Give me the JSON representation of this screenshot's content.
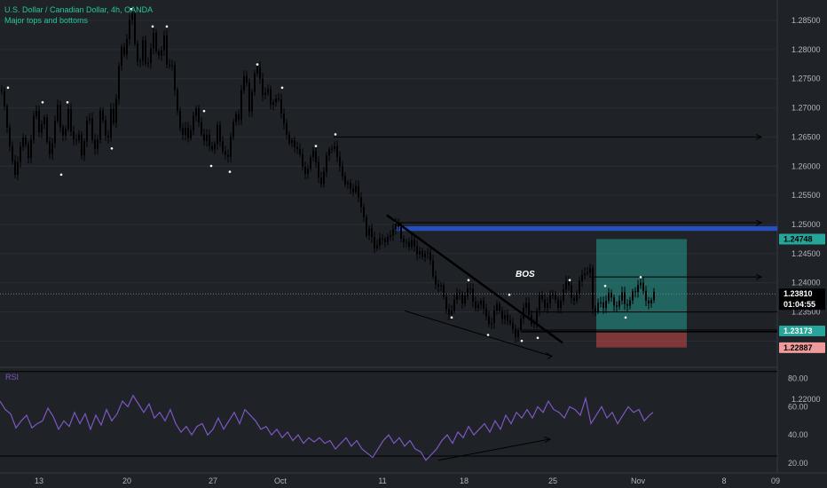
{
  "header": {
    "title": "U.S. Dollar / Canadian Dollar, 4h, OANDA",
    "indicator": "Major tops and bottoms"
  },
  "colors": {
    "background": "#1f2227",
    "candle": "#000000",
    "marker": "#ffffff",
    "rsi_line": "#7e57c2",
    "blue_zone": "#2962ff",
    "target_zone": "#26a69a",
    "stop_zone": "#ef5350",
    "accent_text": "#26c6a0"
  },
  "chart_data": [
    {
      "type": "candlestick",
      "title": "U.S. Dollar / Canadian Dollar, 4h, OANDA",
      "ylim": [
        1.2255,
        1.2885
      ],
      "y_ticks": [
        "1.22000",
        "1.23500",
        "1.24000",
        "1.24500",
        "1.25000",
        "1.25500",
        "1.26000",
        "1.26500",
        "1.27000",
        "1.27500",
        "1.28000",
        "1.28500"
      ],
      "x_ticks": [
        "13",
        "20",
        "27",
        "Oct",
        "11",
        "18",
        "25",
        "Nov",
        "8",
        "09"
      ],
      "close_path": [
        [
          0,
          1.273
        ],
        [
          4,
          1.27
        ],
        [
          8,
          1.266
        ],
        [
          12,
          1.262
        ],
        [
          16,
          1.258
        ],
        [
          20,
          1.261
        ],
        [
          24,
          1.266
        ],
        [
          28,
          1.264
        ],
        [
          32,
          1.26
        ],
        [
          36,
          1.268
        ],
        [
          40,
          1.27
        ],
        [
          44,
          1.265
        ],
        [
          48,
          1.269
        ],
        [
          52,
          1.264
        ],
        [
          56,
          1.262
        ],
        [
          60,
          1.267
        ],
        [
          64,
          1.27
        ],
        [
          68,
          1.265
        ],
        [
          72,
          1.266
        ],
        [
          76,
          1.27
        ],
        [
          80,
          1.264
        ],
        [
          84,
          1.264
        ],
        [
          88,
          1.266
        ],
        [
          92,
          1.261
        ],
        [
          96,
          1.267
        ],
        [
          100,
          1.268
        ],
        [
          104,
          1.264
        ],
        [
          108,
          1.263
        ],
        [
          112,
          1.269
        ],
        [
          116,
          1.267
        ],
        [
          120,
          1.264
        ],
        [
          124,
          1.27
        ],
        [
          128,
          1.266
        ],
        [
          132,
          1.276
        ],
        [
          136,
          1.281
        ],
        [
          140,
          1.279
        ],
        [
          144,
          1.284
        ],
        [
          148,
          1.286
        ],
        [
          152,
          1.28
        ],
        [
          156,
          1.277
        ],
        [
          160,
          1.281
        ],
        [
          164,
          1.276
        ],
        [
          168,
          1.28
        ],
        [
          172,
          1.283
        ],
        [
          176,
          1.278
        ],
        [
          180,
          1.279
        ],
        [
          184,
          1.283
        ],
        [
          188,
          1.276
        ],
        [
          192,
          1.278
        ],
        [
          196,
          1.273
        ],
        [
          200,
          1.269
        ],
        [
          204,
          1.265
        ],
        [
          208,
          1.266
        ],
        [
          212,
          1.264
        ],
        [
          216,
          1.269
        ],
        [
          220,
          1.27
        ],
        [
          224,
          1.266
        ],
        [
          228,
          1.264
        ],
        [
          232,
          1.266
        ],
        [
          236,
          1.263
        ],
        [
          240,
          1.262
        ],
        [
          244,
          1.267
        ],
        [
          248,
          1.264
        ],
        [
          252,
          1.262
        ],
        [
          256,
          1.261
        ],
        [
          260,
          1.266
        ],
        [
          264,
          1.27
        ],
        [
          268,
          1.268
        ],
        [
          272,
          1.274
        ],
        [
          276,
          1.276
        ],
        [
          280,
          1.27
        ],
        [
          284,
          1.274
        ],
        [
          288,
          1.277
        ],
        [
          292,
          1.275
        ],
        [
          296,
          1.272
        ],
        [
          300,
          1.274
        ],
        [
          304,
          1.27
        ],
        [
          308,
          1.271
        ],
        [
          312,
          1.273
        ],
        [
          316,
          1.269
        ],
        [
          320,
          1.266
        ],
        [
          324,
          1.264
        ],
        [
          328,
          1.265
        ],
        [
          332,
          1.263
        ],
        [
          336,
          1.262
        ],
        [
          340,
          1.26
        ],
        [
          344,
          1.259
        ],
        [
          348,
          1.261
        ],
        [
          352,
          1.262
        ],
        [
          356,
          1.26
        ],
        [
          360,
          1.257
        ],
        [
          364,
          1.259
        ],
        [
          368,
          1.262
        ],
        [
          372,
          1.263
        ],
        [
          376,
          1.264
        ],
        [
          380,
          1.261
        ],
        [
          384,
          1.258
        ],
        [
          388,
          1.257
        ],
        [
          392,
          1.258
        ],
        [
          396,
          1.255
        ],
        [
          400,
          1.256
        ],
        [
          404,
          1.254
        ],
        [
          408,
          1.253
        ],
        [
          412,
          1.248
        ],
        [
          416,
          1.249
        ],
        [
          420,
          1.246
        ],
        [
          424,
          1.247
        ],
        [
          428,
          1.248
        ],
        [
          432,
          1.246
        ],
        [
          436,
          1.248
        ],
        [
          440,
          1.249
        ],
        [
          444,
          1.25
        ],
        [
          448,
          1.249
        ],
        [
          452,
          1.247
        ],
        [
          456,
          1.248
        ],
        [
          460,
          1.246
        ],
        [
          464,
          1.247
        ],
        [
          468,
          1.245
        ],
        [
          472,
          1.246
        ],
        [
          476,
          1.244
        ],
        [
          480,
          1.245
        ],
        [
          484,
          1.244
        ],
        [
          488,
          1.241
        ],
        [
          492,
          1.239
        ],
        [
          496,
          1.239
        ],
        [
          500,
          1.237
        ],
        [
          504,
          1.235
        ],
        [
          508,
          1.235
        ],
        [
          512,
          1.237
        ],
        [
          516,
          1.239
        ],
        [
          520,
          1.237
        ],
        [
          524,
          1.238
        ],
        [
          528,
          1.239
        ],
        [
          532,
          1.237
        ],
        [
          536,
          1.236
        ],
        [
          540,
          1.237
        ],
        [
          544,
          1.235
        ],
        [
          548,
          1.234
        ],
        [
          552,
          1.233
        ],
        [
          556,
          1.235
        ],
        [
          560,
          1.236
        ],
        [
          564,
          1.234
        ],
        [
          568,
          1.235
        ],
        [
          572,
          1.233
        ],
        [
          576,
          1.232
        ],
        [
          580,
          1.231
        ],
        [
          584,
          1.233
        ],
        [
          588,
          1.235
        ],
        [
          592,
          1.236
        ],
        [
          596,
          1.234
        ],
        [
          600,
          1.233
        ],
        [
          604,
          1.235
        ],
        [
          608,
          1.238
        ],
        [
          612,
          1.236
        ],
        [
          616,
          1.237
        ],
        [
          620,
          1.238
        ],
        [
          624,
          1.237
        ],
        [
          628,
          1.236
        ],
        [
          632,
          1.238
        ],
        [
          636,
          1.24
        ],
        [
          640,
          1.239
        ],
        [
          644,
          1.237
        ],
        [
          648,
          1.238
        ],
        [
          652,
          1.24
        ],
        [
          656,
          1.241
        ],
        [
          660,
          1.242
        ],
        [
          664,
          1.243
        ],
        [
          668,
          1.233
        ],
        [
          672,
          1.236
        ],
        [
          676,
          1.237
        ],
        [
          680,
          1.236
        ],
        [
          684,
          1.238
        ],
        [
          688,
          1.237
        ],
        [
          692,
          1.236
        ],
        [
          696,
          1.237
        ],
        [
          700,
          1.238
        ],
        [
          704,
          1.235
        ],
        [
          708,
          1.237
        ],
        [
          712,
          1.239
        ],
        [
          716,
          1.238
        ],
        [
          720,
          1.24
        ],
        [
          724,
          1.239
        ],
        [
          728,
          1.237
        ],
        [
          732,
          1.236
        ],
        [
          736,
          1.238
        ]
      ],
      "top_markers": [
        [
          9,
          1.273
        ],
        [
          48,
          1.2705
        ],
        [
          76,
          1.2705
        ],
        [
          148,
          1.2865
        ],
        [
          172,
          1.2835
        ],
        [
          188,
          1.2835
        ],
        [
          230,
          1.269
        ],
        [
          290,
          1.277
        ],
        [
          318,
          1.273
        ],
        [
          356,
          1.263
        ],
        [
          378,
          1.265
        ],
        [
          446,
          1.25
        ],
        [
          528,
          1.24
        ],
        [
          574,
          1.2375
        ],
        [
          642,
          1.24
        ],
        [
          682,
          1.239
        ],
        [
          722,
          1.2405
        ]
      ],
      "bottom_markers": [
        [
          69,
          1.259
        ],
        [
          126,
          1.2635
        ],
        [
          238,
          1.2605
        ],
        [
          259,
          1.2595
        ],
        [
          509,
          1.2345
        ],
        [
          550,
          1.2315
        ],
        [
          588,
          1.2305
        ],
        [
          606,
          1.231
        ],
        [
          705,
          1.2345
        ]
      ],
      "annotations": {
        "bos_label": "BOS",
        "price_tags": [
          {
            "value": 1.24748,
            "text": "1.24748"
          },
          {
            "value": 1.2381,
            "text": "1.23810",
            "countdown": "01:04:55"
          },
          {
            "value": 1.23173,
            "text": "1.23173"
          },
          {
            "value": 1.22887,
            "text": "1.22887"
          }
        ],
        "horizontal_rays": [
          1.265,
          1.2503,
          1.241
        ],
        "blue_zone": [
          1.2489,
          1.2497
        ],
        "target_zone": [
          1.2317,
          1.2475
        ],
        "stop_zone": [
          1.2289,
          1.2317
        ],
        "support_lines": [
          1.2316,
          1.235,
          1.2319
        ],
        "trendline": [
          [
            436,
            1.2516
          ],
          [
            634,
            1.2297
          ]
        ],
        "lower_trendline": [
          [
            456,
            1.2352
          ],
          [
            622,
            1.2274
          ]
        ]
      }
    },
    {
      "type": "line",
      "title": "RSI",
      "ylim": [
        13,
        88
      ],
      "y_ticks": [
        "80.00",
        "60.00",
        "40.00",
        "20.00"
      ],
      "levels": [
        85,
        25
      ],
      "series": [
        {
          "name": "RSI",
          "x": [
            0,
            6,
            12,
            18,
            24,
            30,
            36,
            42,
            48,
            54,
            60,
            66,
            72,
            78,
            84,
            90,
            96,
            102,
            108,
            114,
            120,
            126,
            132,
            138,
            144,
            150,
            156,
            162,
            168,
            174,
            180,
            186,
            192,
            198,
            204,
            210,
            216,
            222,
            228,
            234,
            240,
            246,
            252,
            258,
            264,
            270,
            276,
            282,
            288,
            294,
            300,
            306,
            312,
            318,
            324,
            330,
            336,
            342,
            348,
            354,
            360,
            366,
            372,
            378,
            384,
            390,
            396,
            402,
            408,
            414,
            420,
            426,
            432,
            438,
            444,
            450,
            456,
            462,
            468,
            474,
            480,
            486,
            492,
            498,
            504,
            510,
            516,
            522,
            528,
            534,
            540,
            546,
            552,
            558,
            564,
            570,
            576,
            582,
            588,
            594,
            600,
            606,
            612,
            618,
            624,
            630,
            636,
            642,
            648,
            654,
            660,
            666,
            672,
            678,
            684,
            690,
            696,
            702,
            708,
            714,
            720,
            726,
            732,
            736
          ],
          "values": [
            64,
            58,
            55,
            45,
            50,
            54,
            45,
            48,
            50,
            59,
            53,
            44,
            50,
            46,
            56,
            48,
            55,
            44,
            54,
            47,
            58,
            50,
            55,
            64,
            60,
            68,
            62,
            56,
            62,
            52,
            56,
            50,
            58,
            48,
            42,
            46,
            40,
            46,
            48,
            40,
            44,
            52,
            44,
            50,
            56,
            48,
            58,
            54,
            50,
            44,
            46,
            40,
            44,
            38,
            42,
            36,
            40,
            34,
            38,
            35,
            38,
            34,
            36,
            30,
            34,
            38,
            32,
            36,
            30,
            27,
            24,
            30,
            36,
            40,
            34,
            38,
            32,
            36,
            30,
            28,
            22,
            26,
            30,
            36,
            40,
            34,
            42,
            38,
            46,
            40,
            44,
            48,
            42,
            50,
            44,
            54,
            48,
            56,
            52,
            58,
            52,
            60,
            56,
            64,
            58,
            56,
            52,
            60,
            58,
            54,
            66,
            48,
            54,
            60,
            52,
            56,
            48,
            54,
            60,
            56,
            58,
            50,
            54,
            56
          ]
        }
      ]
    }
  ]
}
